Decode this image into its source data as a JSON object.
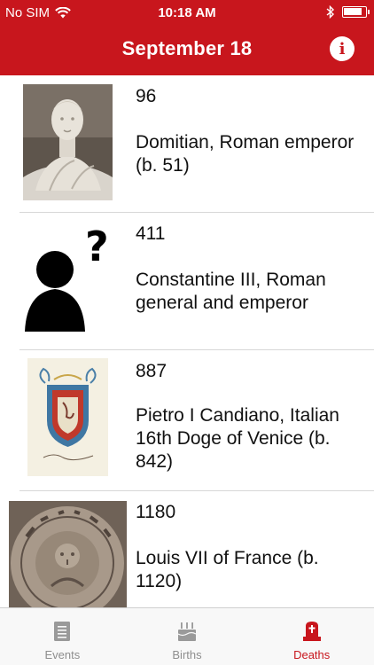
{
  "status_bar": {
    "carrier": "No SIM",
    "time": "10:18 AM",
    "battery_level": 0.85
  },
  "header": {
    "title": "September 18",
    "info_label": "i"
  },
  "entries": [
    {
      "year": "96",
      "text": "Domitian, Roman emperor (b. 51)",
      "image": "bust-portrait"
    },
    {
      "year": "411",
      "text": "Constantine III, Roman general and emperor",
      "image": "unknown-person-placeholder"
    },
    {
      "year": "887",
      "text": "Pietro I Candiano, Italian 16th Doge of Venice (b. 842)",
      "image": "coat-of-arms"
    },
    {
      "year": "1180",
      "text": "Louis VII of France (b. 1120)",
      "image": "silver-coin"
    }
  ],
  "tabs": [
    {
      "label": "Events",
      "icon": "document-icon",
      "active": false
    },
    {
      "label": "Births",
      "icon": "birthday-cake-icon",
      "active": false
    },
    {
      "label": "Deaths",
      "icon": "grave-icon",
      "active": true
    }
  ],
  "colors": {
    "brand": "#c8161d",
    "tab_inactive": "#8e8e8e",
    "separator": "#d8d8d8"
  }
}
